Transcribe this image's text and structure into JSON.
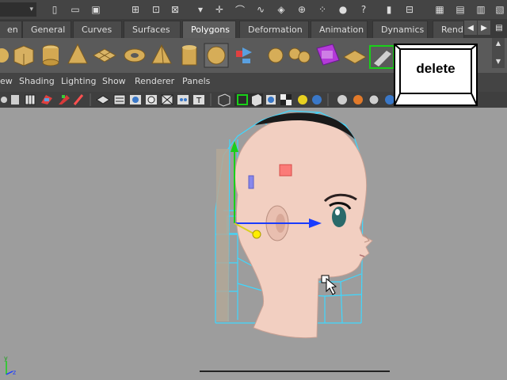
{
  "shelf_tabs": {
    "items": [
      "en",
      "General",
      "Curves",
      "Surfaces",
      "Polygons",
      "Deformation",
      "Animation",
      "Dynamics",
      "Rend"
    ],
    "active": "Polygons"
  },
  "menu": {
    "items": [
      "ew",
      "Shading",
      "Lighting",
      "Show",
      "Renderer",
      "Panels"
    ]
  },
  "overlay": {
    "key_label": "delete"
  },
  "axes": {
    "y_label": "y",
    "z_label": "z"
  },
  "colors": {
    "selection_wire": "#3fd8ff",
    "active_tab": "#5c5c5c",
    "viewport_bg": "#9d9d9d",
    "skin": "#f2cfc1",
    "manipulator_y": "#19d019",
    "manipulator_z": "#1a3cff",
    "manipulator_x": "#ff2222"
  }
}
